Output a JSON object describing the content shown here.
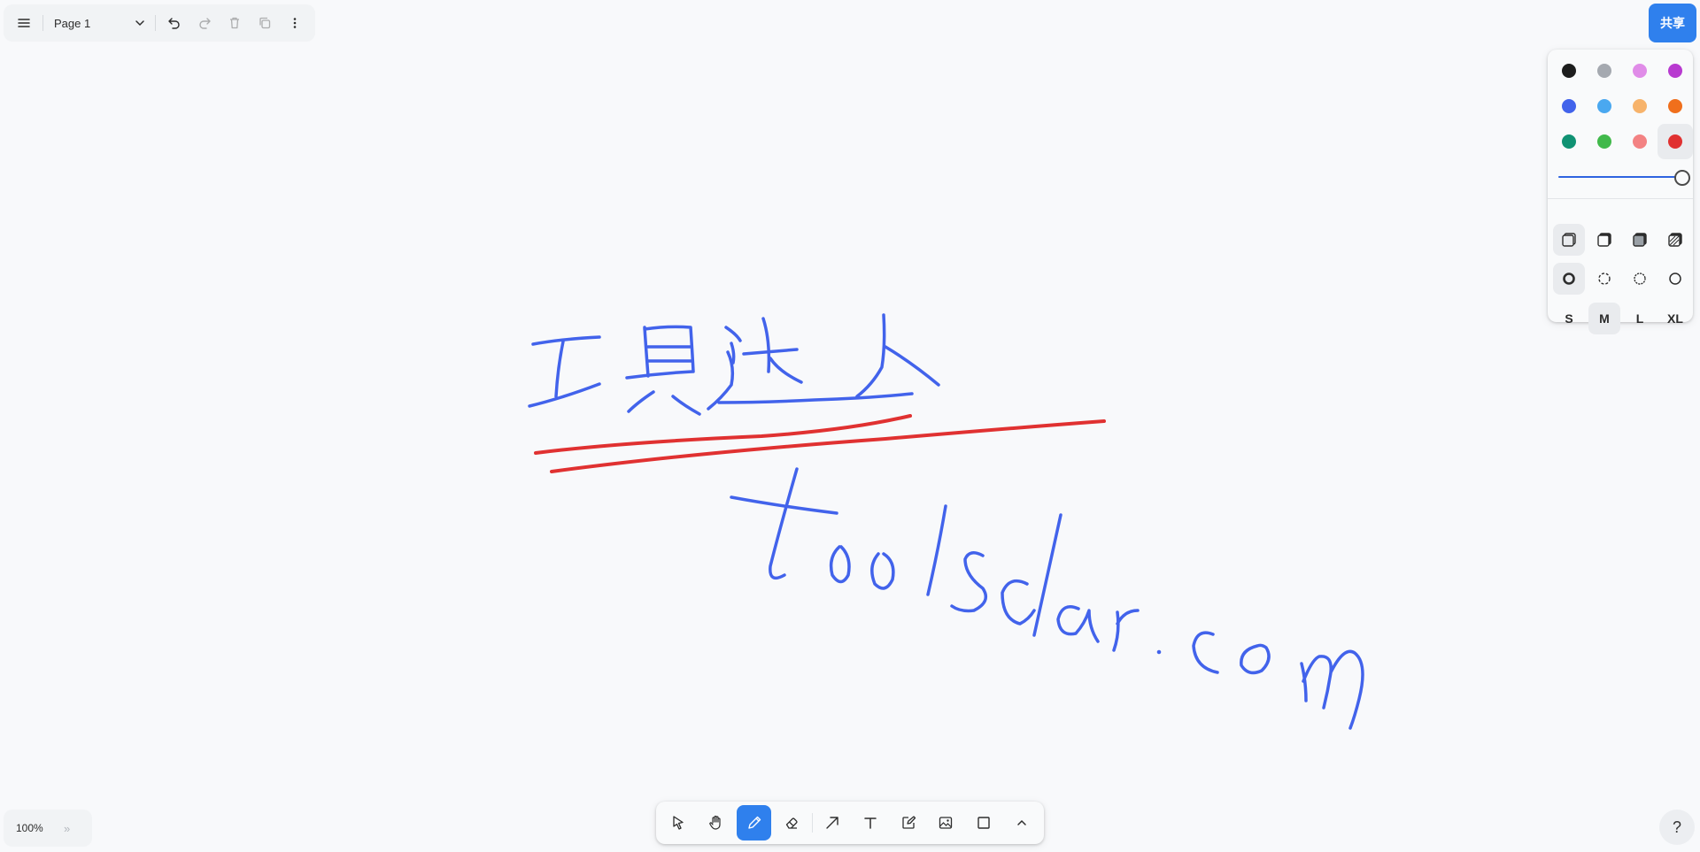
{
  "menu": {
    "page_label": "Page 1"
  },
  "share": {
    "label": "共享"
  },
  "style_panel": {
    "colors": [
      {
        "name": "black",
        "hex": "#1d1d1d"
      },
      {
        "name": "grey",
        "hex": "#a5a9b0"
      },
      {
        "name": "light-violet",
        "hex": "#e08ce8"
      },
      {
        "name": "violet",
        "hex": "#b83ad0"
      },
      {
        "name": "blue",
        "hex": "#4263eb"
      },
      {
        "name": "light-blue",
        "hex": "#4aa8f0"
      },
      {
        "name": "yellow",
        "hex": "#f7b36b"
      },
      {
        "name": "orange",
        "hex": "#f06f1c"
      },
      {
        "name": "green",
        "hex": "#109273"
      },
      {
        "name": "light-green",
        "hex": "#41b94b"
      },
      {
        "name": "light-red",
        "hex": "#f38283"
      },
      {
        "name": "red",
        "hex": "#e03131"
      }
    ],
    "selected_color": "red",
    "opacity": 1.0,
    "fill_options": [
      "fill-none-icon",
      "fill-semi-icon",
      "fill-solid-icon",
      "fill-pattern-icon"
    ],
    "dash_options": [
      "dash-draw-icon",
      "dash-dashed-icon",
      "dash-dotted-icon",
      "dash-solid-icon"
    ],
    "sizes": [
      "S",
      "M",
      "L",
      "XL"
    ],
    "selected_size": "M"
  },
  "zoom": {
    "label": "100%",
    "more": "»"
  },
  "toolbar": {
    "tools": [
      "select",
      "hand",
      "draw",
      "eraser",
      "arrow",
      "text",
      "note",
      "asset",
      "rectangle",
      "more"
    ],
    "active": "draw"
  },
  "help": {
    "label": "?"
  },
  "drawing": {
    "stroke_colors": {
      "blue": "#4263eb",
      "red": "#e03131"
    }
  }
}
